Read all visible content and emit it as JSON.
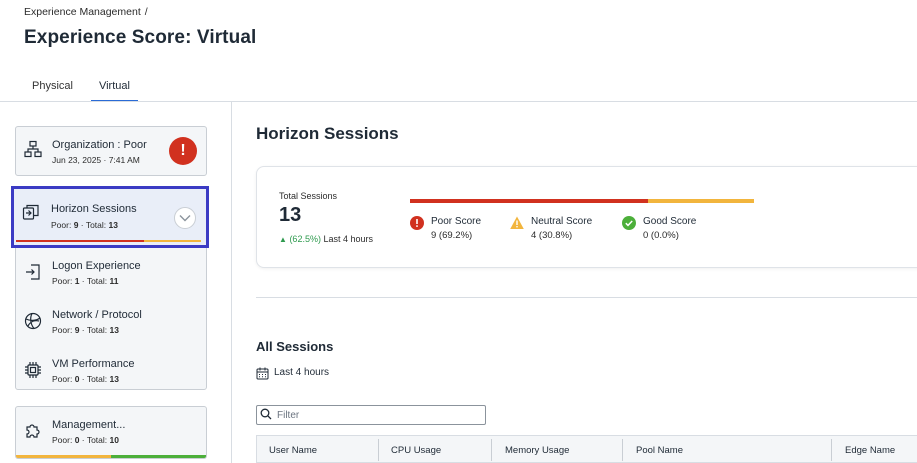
{
  "breadcrumb": {
    "parent": "Experience Management",
    "separator": "/"
  },
  "page_title": "Experience Score: Virtual",
  "tabs": [
    {
      "label": "Physical",
      "active": false
    },
    {
      "label": "Virtual",
      "active": true
    }
  ],
  "sidebar": {
    "organization": {
      "title": "Organization : Poor",
      "subtitle": "Jun 23, 2025 · 7:41 AM",
      "badge": "!"
    },
    "selected": {
      "title": "Horizon Sessions",
      "poor_label": "Poor: ",
      "poor": "9",
      "total_label": " · Total: ",
      "total": "13"
    },
    "items": [
      {
        "title": "Logon Experience",
        "poor_label": "Poor: ",
        "poor": "1",
        "total_label": " · Total: ",
        "total": "11",
        "icon": "login-icon"
      },
      {
        "title": "Network / Protocol",
        "poor_label": "Poor: ",
        "poor": "9",
        "total_label": " · Total: ",
        "total": "13",
        "icon": "globe-icon"
      },
      {
        "title": "VM Performance",
        "poor_label": "Poor: ",
        "poor": "0",
        "total_label": " · Total: ",
        "total": "13",
        "icon": "chip-icon"
      }
    ],
    "management": {
      "title": "Management...",
      "poor_label": "Poor: ",
      "poor": "0",
      "total_label": " · Total: ",
      "total": "10",
      "icon": "puzzle-icon"
    }
  },
  "main": {
    "section_title": "Horizon Sessions",
    "summary": {
      "label": "Total Sessions",
      "value": "13",
      "trend_pct": "(62.5%)",
      "trend_text": "Last 4 hours",
      "segments": [
        {
          "name": "Poor Score",
          "value": "9 (69.2%)",
          "fraction": 0.692,
          "color": "#d1311f"
        },
        {
          "name": "Neutral Score",
          "value": "4 (30.8%)",
          "fraction": 0.308,
          "color": "#f2b53d"
        },
        {
          "name": "Good Score",
          "value": "0 (0.0%)",
          "fraction": 0.0,
          "color": "#4caf3a"
        }
      ]
    },
    "all_sessions": {
      "title": "All Sessions",
      "range": "Last 4 hours",
      "filter_placeholder": "Filter",
      "columns": [
        "User Name",
        "CPU Usage",
        "Memory Usage",
        "Pool Name",
        "Edge Name"
      ]
    }
  },
  "colors": {
    "accent": "#2a6bd6",
    "selection": "#3b3bc4",
    "poor": "#d1311f",
    "neutral": "#f2b53d",
    "good": "#4caf3a"
  }
}
